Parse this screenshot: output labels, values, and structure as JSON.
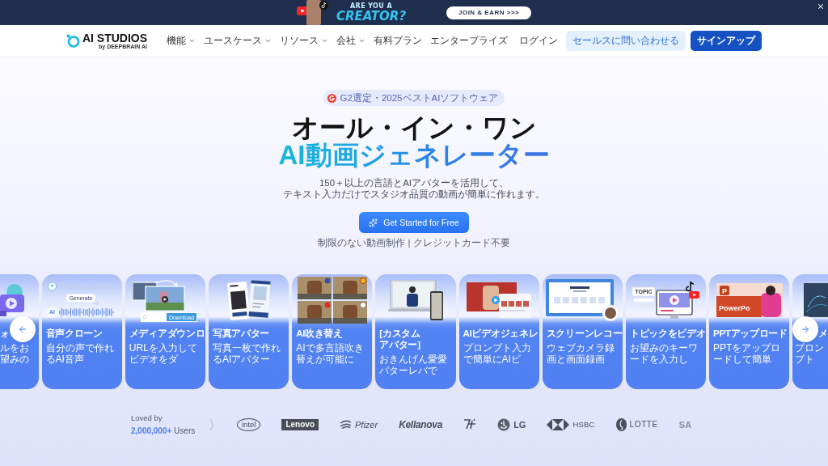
{
  "banner": {
    "kicker": "ARE YOU A",
    "headline": "CREATOR?",
    "button": "JOIN & EARN >>>"
  },
  "nav": {
    "logo": "AI STUDIOS",
    "byline": "by DEEPBRAIN AI",
    "menu": [
      {
        "label": "機能",
        "dropdown": true
      },
      {
        "label": "ユースケース",
        "dropdown": true
      },
      {
        "label": "リソース",
        "dropdown": true
      },
      {
        "label": "会社",
        "dropdown": true
      },
      {
        "label": "有料プラン",
        "dropdown": false
      },
      {
        "label": "エンタープライズ",
        "dropdown": false
      }
    ],
    "login": "ログイン",
    "contact_button": "セールスに問い合わせる",
    "signup_button": "サインアップ"
  },
  "hero": {
    "badge": "G2選定・2025ベストAIソフトウェア",
    "heading": "オール・イン・ワン",
    "heading_highlight": "AI動画ジェネレーター",
    "subtitle": [
      "150＋以上の言語とAIアバターを活用して、",
      "テキスト入力だけでスタジオ品質の動画が簡単に作れます。"
    ],
    "cta": "Get Started for Free",
    "note": "制限のない動画制作 | クレジットカード不要"
  },
  "cards": [
    {
      "kind": "cut-left",
      "title": [
        "ォ"
      ],
      "description": "ルをお望みの"
    },
    {
      "kind": "full",
      "title": [
        "音声クローン"
      ],
      "description": "自分の声で作れるAI音声",
      "image_texts": [
        "Generate",
        "AI"
      ]
    },
    {
      "kind": "full",
      "title": [
        "メディアダウンロ"
      ],
      "description": "URLを入力してビデオをダ",
      "image_texts": [
        "Download"
      ]
    },
    {
      "kind": "full",
      "title": [
        "写真アバター"
      ],
      "description": "写真一枚で作れるAIアバター"
    },
    {
      "kind": "full",
      "title": [
        "AI吹き替え"
      ],
      "description": "AIで多言語吹き替えが可能に"
    },
    {
      "kind": "full",
      "title": [
        "[カスタム",
        "アバター]"
      ],
      "description": "おきんげん愛愛パターレバで"
    },
    {
      "kind": "full",
      "title": [
        "AIビデオジェネレ"
      ],
      "description": "プロンプト入力で簡単にAIビ"
    },
    {
      "kind": "full",
      "title": [
        "スクリーンレコー"
      ],
      "description": "ウェブカメラ録画と画面録画"
    },
    {
      "kind": "full",
      "title": [
        "トピックをビデオ"
      ],
      "description": "お望みのキーワードを入力し",
      "image_texts": [
        "TOPIC"
      ]
    },
    {
      "kind": "full",
      "title": [
        "PPTアップロード"
      ],
      "description": "PPTをアップロードして簡単",
      "image_texts": [
        "P",
        "PowerPo"
      ]
    },
    {
      "kind": "cut-right",
      "title": [
        "メ"
      ],
      "description": "プロンプト"
    }
  ],
  "trust": {
    "label": "Loved by",
    "users": "**2,000,000+** Users",
    "logos": [
      {
        "kind": "fragment"
      },
      {
        "kind": "ring",
        "text": "intel"
      },
      {
        "kind": "boxed",
        "text": "Lenovo"
      },
      {
        "kind": "swoosh",
        "text": "Pfizer"
      },
      {
        "kind": "script",
        "text": "Kellanova"
      },
      {
        "kind": "mark"
      },
      {
        "kind": "circle",
        "text": "LG"
      },
      {
        "kind": "hexagon",
        "text": "HSBC"
      },
      {
        "kind": "leaf",
        "text": "LOTTE"
      },
      {
        "kind": "faded",
        "text": "SA"
      }
    ]
  }
}
